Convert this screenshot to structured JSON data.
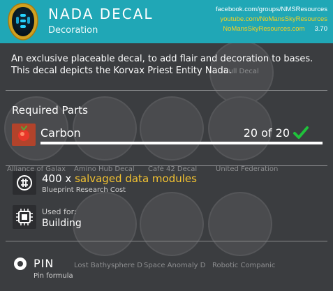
{
  "header": {
    "title": "NADA DECAL",
    "subtitle": "Decoration",
    "links": [
      "facebook.com/groups/NMSResources",
      "youtube.com/NoMansSkyResources",
      "NoMansSkyResources.com"
    ],
    "version": "3.70",
    "accent_color": "#20a7b6",
    "link_highlight_color": "#f5d322"
  },
  "description": "An exclusive placeable decal, to add flair and decoration to bases. This decal depicts the Korvax Priest Entity Nada.",
  "background_items": [
    "Null Decal",
    "Alliance of Galax",
    "Amino Hub Decal",
    "Café 42 Decal",
    "United Federation",
    "Lost Bathysphere D",
    "Space Anomaly D",
    "Robotic Companic"
  ],
  "required_parts": {
    "title": "Required Parts",
    "items": [
      {
        "name": "Carbon",
        "count": "20 of 20",
        "progress": 1.0,
        "icon": "carbon-icon",
        "complete": true
      }
    ]
  },
  "blueprint": {
    "amount": "400 x",
    "item": "salvaged data modules",
    "label": "Blueprint Research Cost",
    "icon": "salvaged-data-icon",
    "highlight_color": "#f5c431"
  },
  "used_for": {
    "label": "Used for:",
    "value": "Building",
    "icon": "chip-icon"
  },
  "pin": {
    "title": "PIN",
    "subtitle": "Pin formula",
    "icon": "pin-icon"
  }
}
